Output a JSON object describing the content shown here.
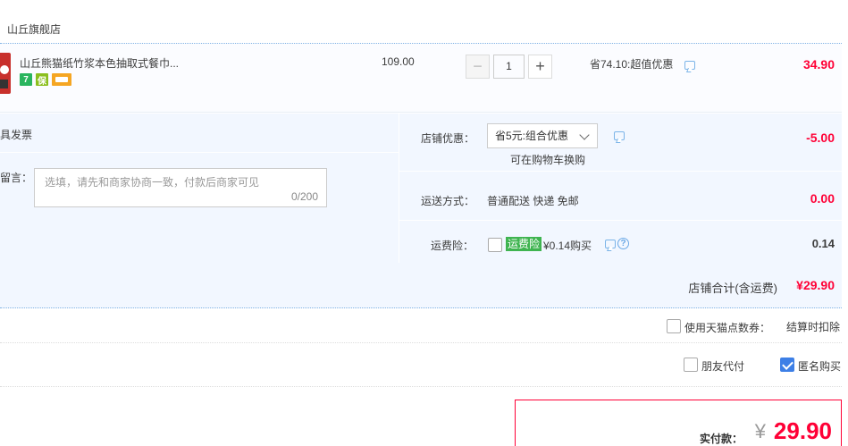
{
  "shop": {
    "name": "山丘旗舰店"
  },
  "item": {
    "title": "山丘熊猫纸竹浆本色抽取式餐巾...",
    "badges": [
      "7",
      "保",
      ""
    ],
    "price": "109.00",
    "quantity": "1",
    "minus_label": "−",
    "plus_label": "+",
    "saving": "省74.10:超值优惠",
    "subtotal": "34.90"
  },
  "order": {
    "invoice_label": "具发票",
    "message_label": "留言：",
    "message_placeholder": "选填，请先和商家协商一致，付款后商家可见",
    "message_count": "0/200"
  },
  "shop_discount": {
    "label": "店铺优惠：",
    "selected": "省5元:组合优惠",
    "hint": "可在购物车换购",
    "amount": "-5.00"
  },
  "shipping": {
    "label": "运送方式：",
    "method": "普通配送 快递 免邮",
    "amount": "0.00"
  },
  "insurance": {
    "label": "运费险：",
    "tag": "运费险",
    "price": "¥0.14购买",
    "help": "?",
    "amount": "0.14"
  },
  "shop_total": {
    "label": "店铺合计(含运费)",
    "amount": "¥29.90"
  },
  "points": {
    "label": "使用天猫点数券：",
    "note": "结算时扣除"
  },
  "options": {
    "friend_pay": "朋友代付",
    "anonymous": "匿名购买"
  },
  "payment": {
    "label": "实付款：",
    "currency": "¥",
    "amount": "29.90"
  },
  "colors": {
    "accent_red": "#ff0036",
    "panel_blue": "#f2f7ff",
    "checkbox_blue": "#3d7fe6",
    "insurance_green": "#3fb450"
  }
}
